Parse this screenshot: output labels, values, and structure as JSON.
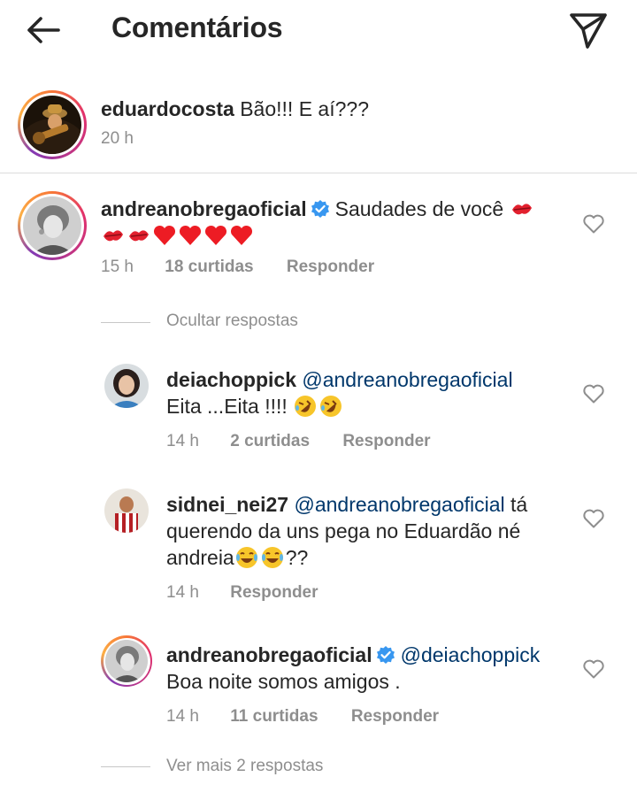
{
  "header": {
    "title": "Comentários"
  },
  "caption": {
    "username": "eduardocosta",
    "text": "Bão!!! E aí???",
    "time": "20 h"
  },
  "comment1": {
    "username": "andreanobregaoficial",
    "text": "Saudades de você",
    "time": "15 h",
    "likes": "18 curtidas",
    "reply": "Responder"
  },
  "hide_replies": "Ocultar respostas",
  "reply1": {
    "username": "deiachoppick",
    "mention": "@andreanobregaoficial",
    "text": "Eita ...Eita !!!!",
    "time": "14 h",
    "likes": "2 curtidas",
    "reply": "Responder"
  },
  "reply2": {
    "username": "sidnei_nei27",
    "mention": "@andreanobregaoficial",
    "text_line1": "tá",
    "text_line2": "querendo da uns pega no Eduardão né",
    "text_line3a": "andreia",
    "text_line3b": "??",
    "time": "14 h",
    "reply": "Responder"
  },
  "reply3": {
    "username": "andreanobregaoficial",
    "mention": "@deiachoppick",
    "text": "Boa noite somos amigos .",
    "time": "14 h",
    "likes": "11 curtidas",
    "reply": "Responder"
  },
  "more_replies": "Ver mais 2 respostas",
  "colors": {
    "text": "#262626",
    "muted": "#8e8e8e",
    "mention": "#00376b",
    "verified": "#3897f0",
    "heart_red": "#ed1c24"
  },
  "icons": {
    "back": "arrow-left-icon",
    "send": "paper-plane-icon",
    "like": "heart-outline-icon",
    "verified": "verified-badge-icon"
  }
}
